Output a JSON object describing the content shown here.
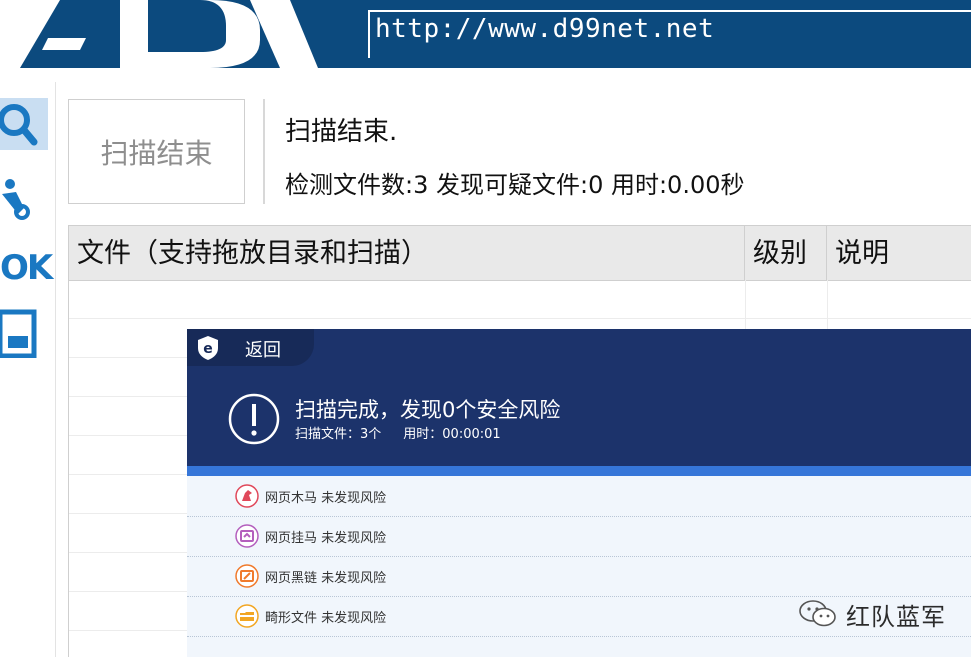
{
  "banner": {
    "url": "http://www.d99net.net",
    "logo_text": "AD",
    "bg_color": "#0c4a7e"
  },
  "toolbar": {
    "items": [
      {
        "name": "scan",
        "icon": "magnifier-icon",
        "active": true
      },
      {
        "name": "tools",
        "icon": "wrench-person-icon"
      },
      {
        "name": "ok",
        "label": "OK"
      },
      {
        "name": "window",
        "icon": "window-icon"
      }
    ]
  },
  "scan": {
    "button_label": "扫描结束",
    "status": "扫描结束.",
    "summary": "检测文件数:3 发现可疑文件:0 用时:0.00秒"
  },
  "table": {
    "columns": [
      "文件（支持拖放目录和扫描）",
      "级别",
      "说明"
    ],
    "rows": []
  },
  "dialog": {
    "back_label": "返回",
    "title": "扫描完成，发现0个安全风险",
    "files_scanned": "扫描文件：3个",
    "elapsed": "用时：00:00:01",
    "header_color": "#1c336b",
    "accent_color": "#3676d8",
    "risks": [
      {
        "icon": "trojan-icon",
        "label": "网页木马 未发现风险",
        "color": "#e0485a"
      },
      {
        "icon": "hang-horse-icon",
        "label": "网页挂马 未发现风险",
        "color": "#b45fbd"
      },
      {
        "icon": "black-link-icon",
        "label": "网页黑链 未发现风险",
        "color": "#f07a2c"
      },
      {
        "icon": "folder-icon",
        "label": "畸形文件 未发现风险",
        "color": "#f2a623"
      }
    ]
  },
  "watermark": {
    "text": "红队蓝军",
    "icon": "wechat-icon"
  }
}
